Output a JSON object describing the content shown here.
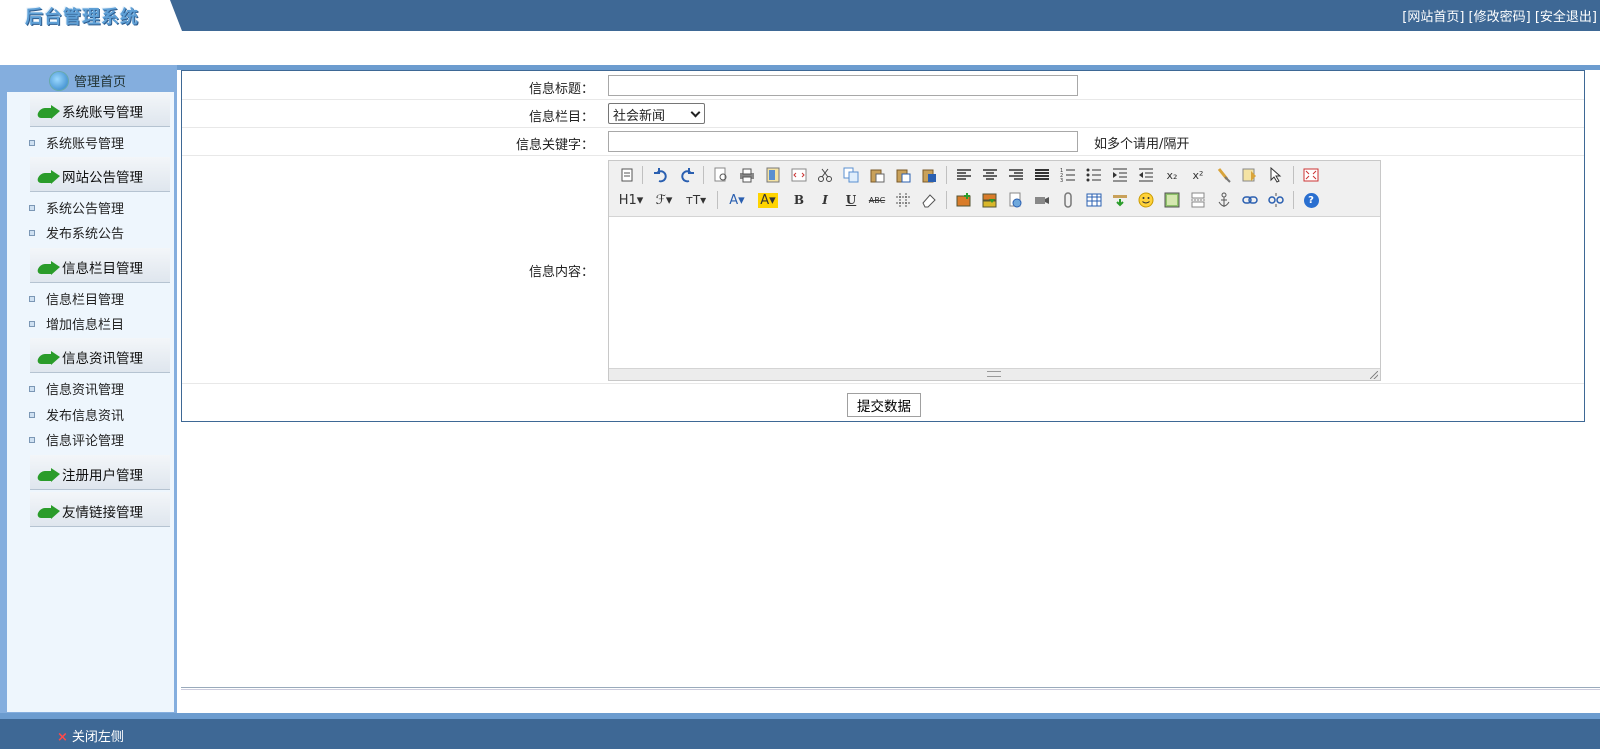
{
  "app": {
    "logo_text": "后台管理系统"
  },
  "header": {
    "links": [
      "[网站首页]",
      "[修改密码]",
      "[安全退出]"
    ]
  },
  "sidebar": {
    "home_label": "管理首页",
    "sections": [
      {
        "label": "系统账号管理",
        "items": [
          "系统账号管理"
        ]
      },
      {
        "label": "网站公告管理",
        "items": [
          "系统公告管理",
          "发布系统公告"
        ]
      },
      {
        "label": "信息栏目管理",
        "items": [
          "信息栏目管理",
          "增加信息栏目"
        ]
      },
      {
        "label": "信息资讯管理",
        "items": [
          "信息资讯管理",
          "发布信息资讯",
          "信息评论管理"
        ]
      },
      {
        "label": "注册用户管理",
        "items": []
      },
      {
        "label": "友情链接管理",
        "items": []
      }
    ]
  },
  "form": {
    "title_label": "信息标题：",
    "title_value": "",
    "category_label": "信息栏目：",
    "category_selected": "社会新闻",
    "keywords_label": "信息关键字：",
    "keywords_value": "",
    "keywords_hint": "如多个请用/隔开",
    "content_label": "信息内容：",
    "submit_label": "提交数据"
  },
  "editor": {
    "toolbar_row1": [
      "source-icon",
      "undo-icon",
      "redo-icon",
      "preview-icon",
      "print-icon",
      "template-icon",
      "code-icon",
      "cut-icon",
      "copy-icon",
      "paste-icon",
      "paste-plain-icon",
      "paste-word-icon",
      "align-left-icon",
      "align-center-icon",
      "align-right-icon",
      "align-justify-icon",
      "ordered-list-icon",
      "unordered-list-icon",
      "indent-icon",
      "outdent-icon",
      "subscript-icon",
      "superscript-icon",
      "clear-format-icon",
      "select-all-icon",
      "cursor-icon",
      "fullscreen-icon"
    ],
    "toolbar_row2": [
      "heading-icon",
      "font-family-icon",
      "font-size-icon",
      "font-color-icon",
      "highlight-color-icon",
      "bold-icon",
      "italic-icon",
      "underline-icon",
      "strikethrough-icon",
      "line-height-icon",
      "eraser-icon",
      "image-icon",
      "multi-image-icon",
      "flash-icon",
      "media-icon",
      "attachment-icon",
      "table-icon",
      "hr-icon",
      "emoticon-icon",
      "map-icon",
      "page-break-icon",
      "anchor-icon",
      "link-icon",
      "unlink-icon",
      "help-icon"
    ],
    "glyphs": {
      "heading": "H1▾",
      "font_family": "ℱ▾",
      "font_size": "тT▾",
      "font_color": "A▾",
      "highlight": "A▾",
      "bold": "B",
      "italic": "I",
      "underline": "U",
      "strike": "ABC",
      "sub": "x₂",
      "sup": "x²",
      "help": "?"
    }
  },
  "footer": {
    "close_left_label": "关闭左侧"
  },
  "colors": {
    "header": "#3e6895",
    "sidebar": "#84aede",
    "sidebar_inner": "#eef6fd",
    "accent_green": "#2a9c2a"
  }
}
